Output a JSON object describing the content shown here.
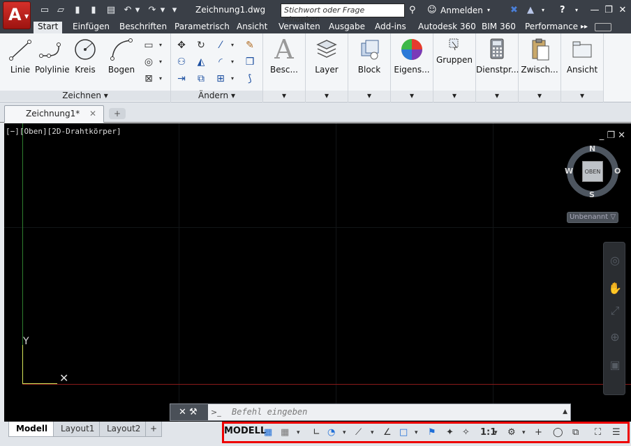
{
  "window": {
    "title": "Zeichnung1.dwg",
    "search_placeholder": "Stichwort oder Frage eingeben",
    "login": "Anmelden"
  },
  "app_button": {
    "letter": "A",
    "dropdown": "▼"
  },
  "icons": {
    "new": "▭",
    "open": "▱",
    "save": "▮",
    "saveas": "▮",
    "print": "▤",
    "undo": "↶",
    "redo": "↷",
    "dd": "▾",
    "binoculars": "⚲",
    "user": "☺",
    "exchange": "✖",
    "triangle": "▲",
    "help": "?",
    "minimize": "—",
    "restore": "❐",
    "close": "✕"
  },
  "ribbon_tabs": [
    "Start",
    "Einfügen",
    "Beschriften",
    "Parametrisch",
    "Ansicht",
    "Verwalten",
    "Ausgabe",
    "Add-ins",
    "Autodesk 360",
    "BIM 360",
    "Performance"
  ],
  "ribbon_more": "▸▸",
  "panels": {
    "zeichnen": {
      "title": "Zeichnen ▾",
      "buttons": [
        "Linie",
        "Polylinie",
        "Kreis",
        "Bogen"
      ]
    },
    "aendern": {
      "title": "Ändern ▾"
    },
    "big": [
      "Besc...",
      "Layer",
      "Block",
      "Eigens...",
      "Gruppen",
      "Dienstpr...",
      "Zwisch...",
      "Ansicht"
    ]
  },
  "doc_tabs": {
    "current": "Zeichnung1*",
    "close": "✕",
    "new": "+"
  },
  "viewport": {
    "label": "[−][Oben][2D-Drahtkörper]",
    "y_label": "Y",
    "x_label": "✕",
    "controls": "_ ❐ ✕",
    "viewcube": {
      "N": "N",
      "S": "S",
      "E": "O",
      "W": "W",
      "face": "OBEN",
      "ucs": "Unbenannt ▽"
    }
  },
  "command_line": {
    "tools": "✕ ⚒",
    "prompt": ">_",
    "placeholder": "Befehl eingeben",
    "up": "▲"
  },
  "layout_tabs": [
    "Modell",
    "Layout1",
    "Layout2",
    "+"
  ],
  "status": {
    "model": "MODELL",
    "scale": "1:1"
  }
}
